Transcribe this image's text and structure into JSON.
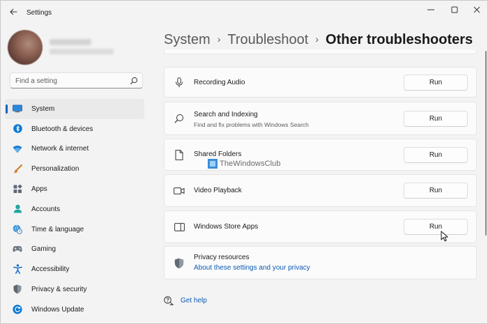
{
  "window": {
    "title": "Settings"
  },
  "search": {
    "placeholder": "Find a setting"
  },
  "nav": {
    "items": [
      {
        "label": "System",
        "icon": "monitor-icon",
        "active": true
      },
      {
        "label": "Bluetooth & devices",
        "icon": "bluetooth-icon"
      },
      {
        "label": "Network & internet",
        "icon": "wifi-icon"
      },
      {
        "label": "Personalization",
        "icon": "brush-icon"
      },
      {
        "label": "Apps",
        "icon": "apps-icon"
      },
      {
        "label": "Accounts",
        "icon": "person-icon"
      },
      {
        "label": "Time & language",
        "icon": "globe-clock-icon"
      },
      {
        "label": "Gaming",
        "icon": "gamepad-icon"
      },
      {
        "label": "Accessibility",
        "icon": "accessibility-icon"
      },
      {
        "label": "Privacy & security",
        "icon": "shield-icon"
      },
      {
        "label": "Windows Update",
        "icon": "update-icon"
      }
    ]
  },
  "breadcrumb": {
    "items": [
      "System",
      "Troubleshoot"
    ],
    "separator": "›",
    "current": "Other troubleshooters"
  },
  "troubleshooters": [
    {
      "title": "Recording Audio",
      "subtitle": "",
      "icon": "microphone-icon",
      "button": "Run"
    },
    {
      "title": "Search and Indexing",
      "subtitle": "Find and fix problems with Windows Search",
      "icon": "search-icon",
      "button": "Run"
    },
    {
      "title": "Shared Folders",
      "subtitle": "",
      "icon": "file-icon",
      "button": "Run"
    },
    {
      "title": "Video Playback",
      "subtitle": "",
      "icon": "video-camera-icon",
      "button": "Run"
    },
    {
      "title": "Windows Store Apps",
      "subtitle": "",
      "icon": "window-icon",
      "button": "Run"
    }
  ],
  "privacy": {
    "title": "Privacy resources",
    "link": "About these settings and your privacy",
    "icon": "shield-icon"
  },
  "help": {
    "label": "Get help",
    "icon": "help-chat-icon"
  },
  "watermark": {
    "text": "TheWindowsClub"
  },
  "colors": {
    "accent": "#0067c0",
    "link": "#0a5bb5",
    "background": "#f3f3f3",
    "card": "#fbfbfb"
  }
}
